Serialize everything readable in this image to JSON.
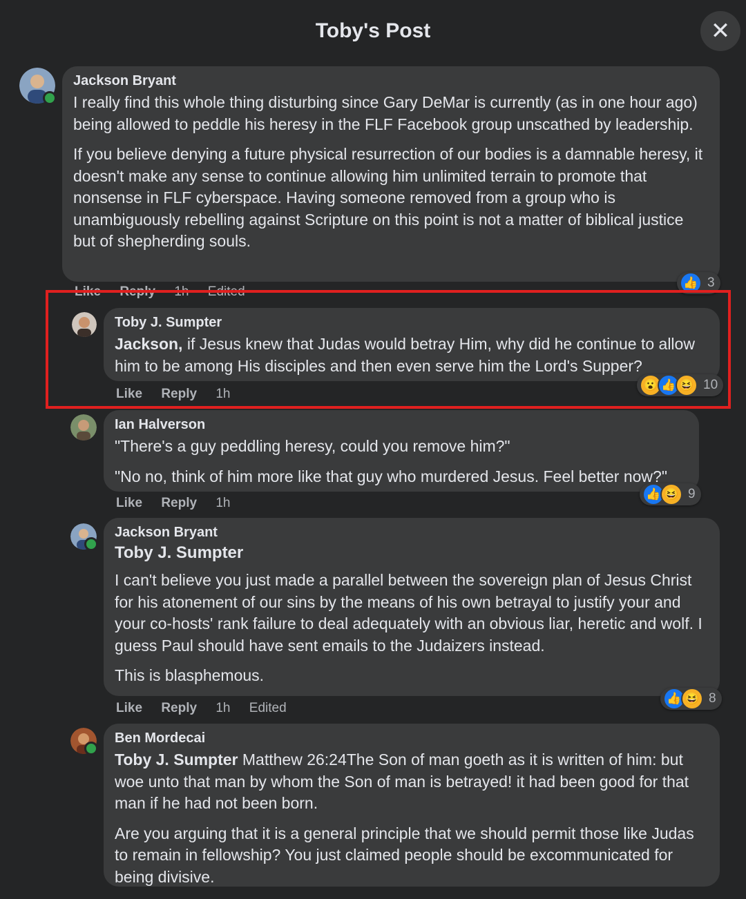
{
  "modal": {
    "title": "Toby's Post",
    "close_icon": "close-icon"
  },
  "comments": [
    {
      "author": "Jackson Bryant",
      "paragraphs": [
        "I really find this whole thing disturbing since Gary DeMar is currently (as in one hour ago) being allowed to peddle his heresy in the FLF Facebook group unscathed by leadership.",
        "If you believe denying a future physical resurrection of our bodies is a damnable heresy, it doesn't make any sense to continue allowing him unlimited terrain to promote that nonsense in FLF cyberspace. Having someone removed from a group who is unambiguously rebelling against Scripture on this point is not a matter of biblical justice but of shepherding souls."
      ],
      "actions": {
        "like": "Like",
        "reply": "Reply",
        "time": "1h",
        "edited": "Edited"
      },
      "reactions": {
        "count": "3"
      }
    },
    {
      "author": "Toby J. Sumpter",
      "mention": "Jackson,",
      "paragraphs": [
        " if Jesus knew that Judas would betray Him, why did he continue to allow him to be among His disciples and then even serve him the Lord's Supper?"
      ],
      "actions": {
        "like": "Like",
        "reply": "Reply",
        "time": "1h"
      },
      "reactions": {
        "count": "10"
      }
    },
    {
      "author": "Ian Halverson",
      "paragraphs": [
        "\"There's a guy peddling heresy, could you remove him?\"",
        "\"No no, think of him more like that guy who murdered Jesus. Feel better now?\""
      ],
      "actions": {
        "like": "Like",
        "reply": "Reply",
        "time": "1h"
      },
      "reactions": {
        "count": "9"
      }
    },
    {
      "author": "Jackson Bryant",
      "mention": "Toby J. Sumpter",
      "paragraphs": [
        "I can't believe you just made a parallel between the sovereign plan of Jesus Christ for his atonement of our sins by the means of his own betrayal to justify your and your co-hosts' rank failure to deal adequately with an obvious liar, heretic and wolf. I guess Paul should have sent emails to the Judaizers instead.",
        "This is blasphemous."
      ],
      "actions": {
        "like": "Like",
        "reply": "Reply",
        "time": "1h",
        "edited": "Edited"
      },
      "reactions": {
        "count": "8"
      }
    },
    {
      "author": "Ben Mordecai",
      "mention": "Toby J. Sumpter",
      "paragraphs": [
        " Matthew 26:24The Son of man goeth as it is written of him: but woe unto that man by whom the Son of man is betrayed! it had been good for that man if he had not been born.",
        "Are you arguing that it is a general principle that we should permit those like Judas to remain in fellowship? You just claimed people should be excommunicated for being divisive."
      ]
    }
  ],
  "colors": {
    "highlight": "#e0201f",
    "like_blue": "#1877f2",
    "online_green": "#31a24c"
  }
}
